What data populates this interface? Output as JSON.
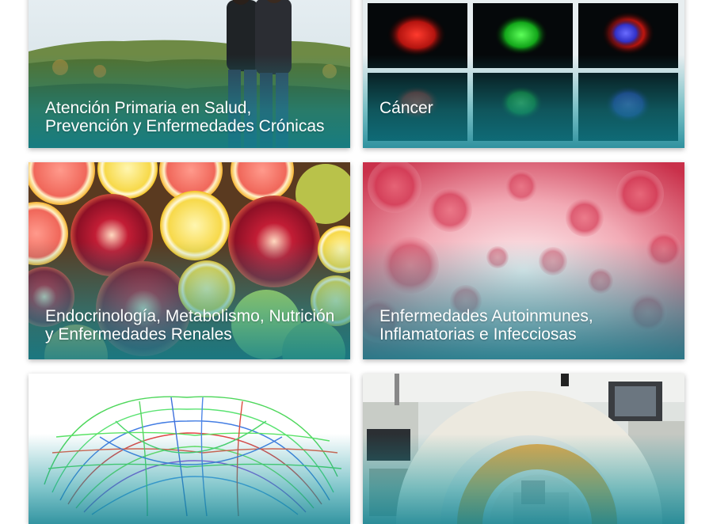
{
  "tiles": [
    {
      "id": "atencion-primaria",
      "label": "Atención Primaria en Salud, Prevención y Enfermedades Crónicas",
      "image": "couple-on-hill-photo"
    },
    {
      "id": "cancer",
      "label": "Cáncer",
      "image": "fluorescent-cells-microscopy-grid"
    },
    {
      "id": "endocrinologia",
      "label": "Endocrinología, Metabolismo, Nutrición y Enfermedades Renales",
      "image": "citrus-and-pomegranate-photo"
    },
    {
      "id": "autoinmunes",
      "label": "Enfermedades Autoinmunes, Inflamatorias e Infecciosas",
      "image": "red-blood-cells-illustration"
    },
    {
      "id": "neurociencias",
      "label": "",
      "image": "brain-tractography-fibers"
    },
    {
      "id": "imagen",
      "label": "",
      "image": "c-arm-operating-room-photo"
    }
  ],
  "colors": {
    "overlay_teal": "#1896a0",
    "caption_text": "#ffffff"
  }
}
